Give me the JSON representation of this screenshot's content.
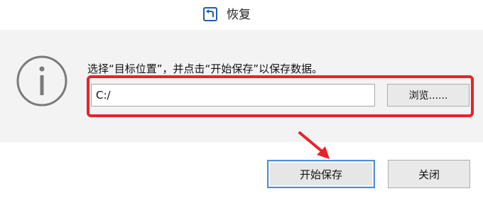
{
  "window": {
    "title": "恢复",
    "icon": "restore-arrow-icon"
  },
  "dialog": {
    "info_icon": "info-icon",
    "instruction": "选择“目标位置”，并点击“开始保存”以保存数据。",
    "path_value": "C:/",
    "browse_label": "浏览......",
    "highlight_color": "#e8222a"
  },
  "footer": {
    "start_label": "开始保存",
    "close_label": "关闭",
    "arrow_icon": "red-arrow-icon",
    "focus_color": "#4a90d9"
  }
}
